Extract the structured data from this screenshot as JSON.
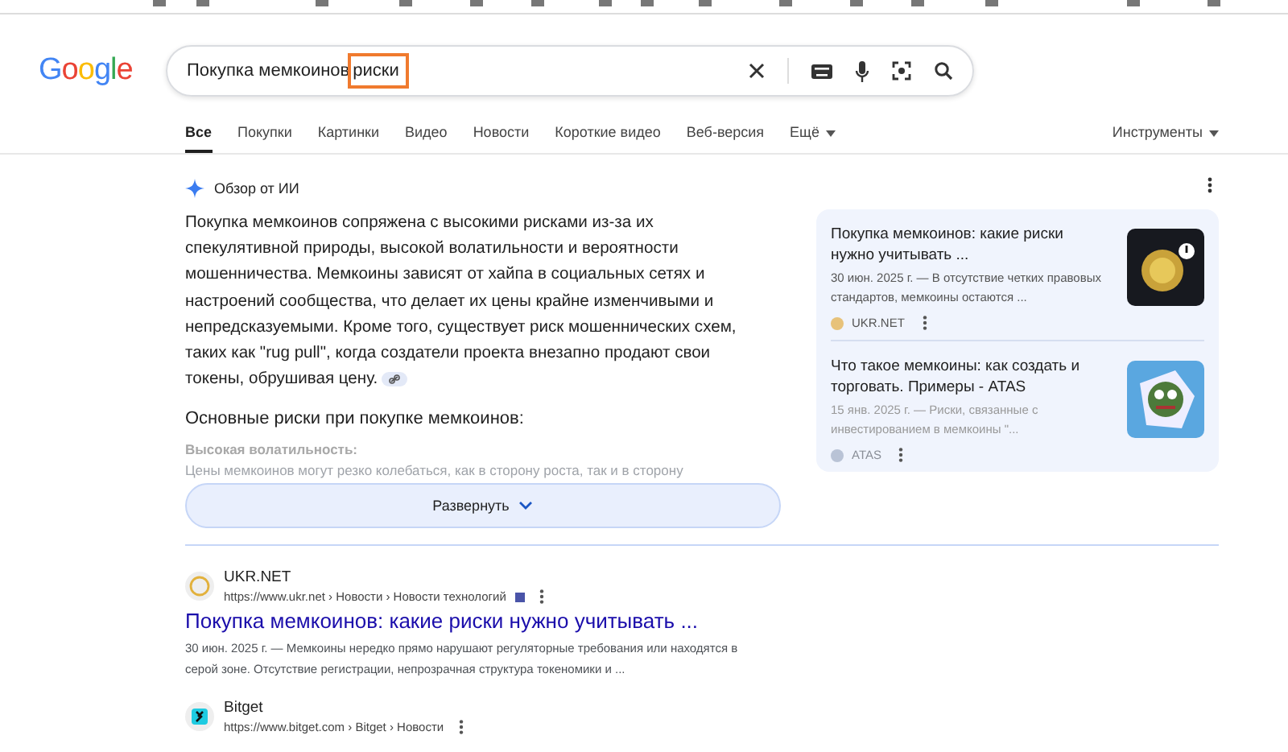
{
  "logo": "Google",
  "search": {
    "query": "Покупка мемкоинов",
    "highlighted": "риски"
  },
  "tabs": [
    {
      "label": "Все",
      "selected": true
    },
    {
      "label": "Покупки",
      "selected": false
    },
    {
      "label": "Картинки",
      "selected": false
    },
    {
      "label": "Видео",
      "selected": false
    },
    {
      "label": "Новости",
      "selected": false
    },
    {
      "label": "Короткие видео",
      "selected": false
    },
    {
      "label": "Веб-версия",
      "selected": false
    },
    {
      "label": "Ещё",
      "selected": false,
      "dropdown": true
    }
  ],
  "tools": "Инструменты",
  "ai_overview": {
    "title": "Обзор от ИИ",
    "summary": "Покупка мемкоинов сопряжена с высокими рисками из-за их спекулятивной природы, высокой волатильности и вероятности мошенничества. Мемкоины зависят от хайпа в социальных сетях и настроений сообщества, что делает их цены крайне изменчивыми и непредсказуемыми. Кроме того, существует риск мошеннических схем, таких как \"rug pull\", когда создатели проекта внезапно продают свои токены, обрушивая цену.",
    "heading": "Основные риски при покупке мемкоинов:",
    "risk_title": "Высокая волатильность:",
    "risk_text": "Цены мемкоинов могут резко колебаться, как в сторону роста, так и в сторону",
    "expand_button": "Развернуть",
    "sources": [
      {
        "title": "Покупка мемкоинов: какие риски нужно учитывать ...",
        "snippet": "30 июн. 2025 г. — В отсутствие четких правовых стандартов, мемкоины остаются ...",
        "site": "UKR.NET",
        "kind": "coin"
      },
      {
        "title": "Что такое мемкоины: как создать и торговать. Примеры - ATAS",
        "snippet": "15 янв. 2025 г. — Риски, связанные с инвестированием в мемкоины \"...",
        "site": "ATAS",
        "kind": "frog"
      }
    ]
  },
  "results": [
    {
      "site": "UKR.NET",
      "url": "https://www.ukr.net › Новости › Новости технологий",
      "title": "Покупка мемкоинов: какие риски нужно учитывать ...",
      "snippet": "30 июн. 2025 г. — Мемкоины нередко прямо нарушают регуляторные требования или находятся в серой зоне. Отсутствие регистрации, непрозрачная структура токеномики и ...",
      "kind": "ukr"
    },
    {
      "site": "Bitget",
      "url": "https://www.bitget.com › Bitget › Новости",
      "kind": "bitget"
    }
  ]
}
